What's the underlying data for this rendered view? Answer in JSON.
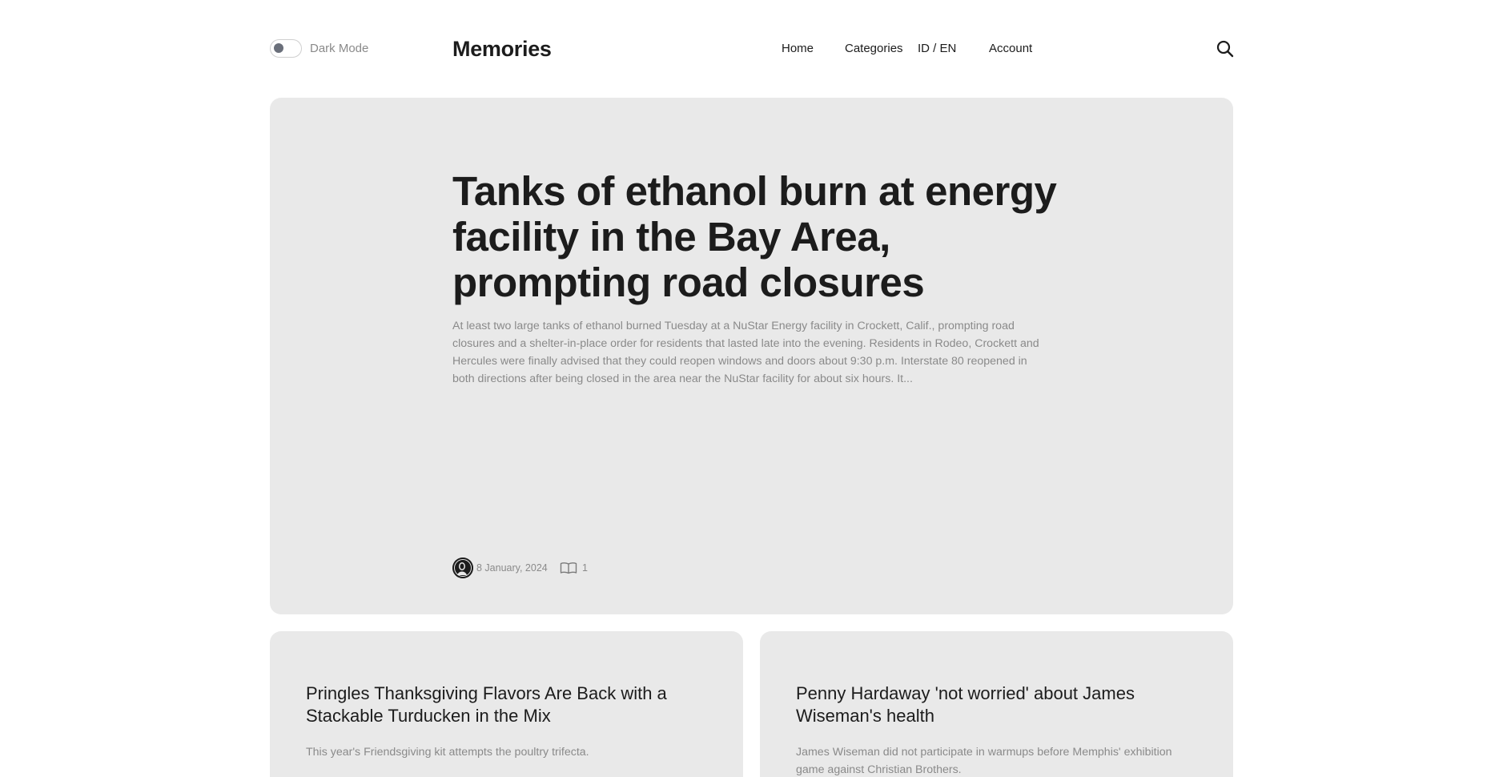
{
  "header": {
    "dark_mode_label": "Dark Mode",
    "brand": "Memories",
    "nav": {
      "home": "Home",
      "categories": "Categories",
      "language": "ID / EN",
      "account": "Account"
    },
    "search_icon": "search-icon",
    "toggle_knob_color": "#6a6f7a"
  },
  "hero": {
    "title": "Tanks of ethanol burn at energy facility in the Bay Area, prompting road closures",
    "excerpt": "At least two large tanks of ethanol burned Tuesday at a NuStar Energy facility in Crockett, Calif., prompting road closures and a shelter-in-place order for residents that lasted late into the evening. Residents in Rodeo, Crockett and Hercules were finally advised that they could reopen windows and doors about 9:30 p.m. Interstate 80 reopened in both directions after being closed in the area near the NuStar facility for about six hours. It...",
    "date": "8 January, 2024",
    "read_count": "1",
    "read_icon": "open-book-icon"
  },
  "cards": [
    {
      "title": "Pringles Thanksgiving Flavors Are Back with a Stackable Turducken in the Mix",
      "excerpt": "This year's Friendsgiving kit attempts the poultry trifecta."
    },
    {
      "title": "Penny Hardaway 'not worried' about James Wiseman's health",
      "excerpt": "James Wiseman did not participate in warmups before Memphis' exhibition game against Christian Brothers."
    }
  ],
  "colors": {
    "card_background": "#e9e9e9",
    "text_primary": "#1c1c1c",
    "text_muted": "#8a8a8a"
  }
}
